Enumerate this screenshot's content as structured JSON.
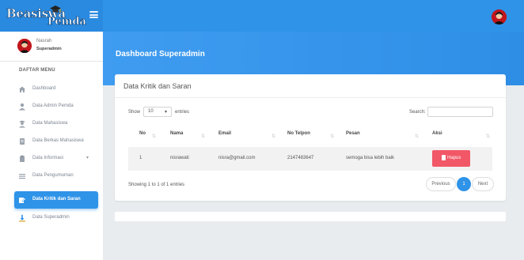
{
  "brand": {
    "word1": "Beasiswa",
    "word2": "Pemda"
  },
  "user": {
    "name": "Nasrah",
    "role": "Superadmin"
  },
  "sidebar": {
    "menu_title": "DAFTAR MENU",
    "items": [
      {
        "label": "Dashboard",
        "icon": "home-icon"
      },
      {
        "label": "Data Admin Pemda",
        "icon": "user-icon"
      },
      {
        "label": "Data Mahasiswa",
        "icon": "user-graduate-icon"
      },
      {
        "label": "Data Berkas Mahasiswa",
        "icon": "file-icon"
      },
      {
        "label": "Data Informasi",
        "icon": "clipboard-icon",
        "chevron": "▾"
      },
      {
        "label": "Data Pengumuman",
        "icon": "list-icon"
      },
      {
        "label": "Data Kritik dan Saran",
        "icon": "edit-icon",
        "active": true
      },
      {
        "label": "Data Superadmin",
        "icon": "download-icon"
      }
    ]
  },
  "header": {
    "title": "Dashboard Superadmin"
  },
  "card": {
    "title": "Data Kritik dan Saran",
    "show_label": "Show",
    "entries_value": "10",
    "entries_label": "entries",
    "search_label": "Search:",
    "search_value": "",
    "columns": [
      "No",
      "Nama",
      "Email",
      "No Telpon",
      "Pesan",
      "Aksi"
    ],
    "rows": [
      {
        "no": "1",
        "nama": "nisrawati",
        "email": "nisra@gmail.com",
        "telpon": "2147483647",
        "pesan": "semoga bisa lebih baik",
        "aksi": "Hapus"
      }
    ],
    "showing_text": "Showing 1 to 1 of 1 entries",
    "pagination": {
      "prev": "Previous",
      "current": "1",
      "next": "Next"
    }
  },
  "colors": {
    "primary": "#2f93e8",
    "danger": "#f25767",
    "avatar": "#c0161c"
  }
}
